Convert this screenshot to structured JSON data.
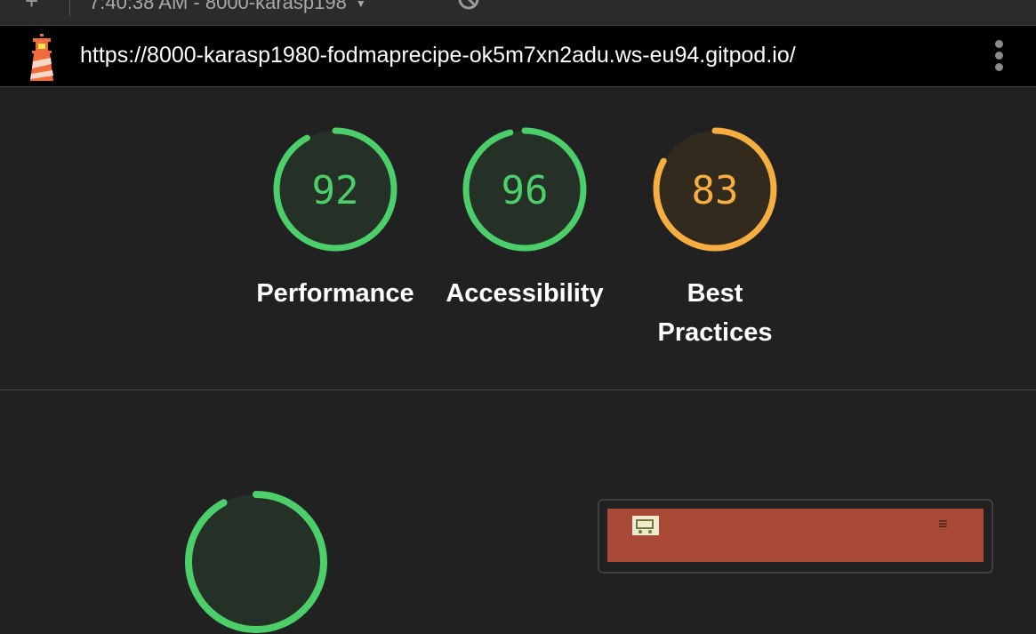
{
  "toolbar": {
    "add_label": "+",
    "report_label": "7:40:38 AM - 8000-karasp198",
    "dropdown_glyph": "▼"
  },
  "header": {
    "url": "https://8000-karasp1980-fodmaprecipe-ok5m7xn2adu.ws-eu94.gitpod.io/"
  },
  "colors": {
    "pass": "#4ccf6a",
    "average": "#f6ae40",
    "pass_fill": "#253026",
    "average_fill": "#332a1e",
    "background": "#212121"
  },
  "scores": [
    {
      "label": "Performance",
      "value": "92",
      "status": "pass"
    },
    {
      "label": "Accessibility",
      "value": "96",
      "status": "pass"
    },
    {
      "label": "Best Practices",
      "value": "83",
      "status": "average"
    }
  ],
  "detail": {
    "performance_gauge_status": "pass",
    "thumbnail_menu_glyph": "≡"
  },
  "icons": {
    "add": "plus-icon",
    "clear": "block-icon",
    "logo": "lighthouse-icon",
    "menu": "vertical-dots-icon",
    "brand": "cart-icon",
    "hamburger": "hamburger-icon"
  }
}
